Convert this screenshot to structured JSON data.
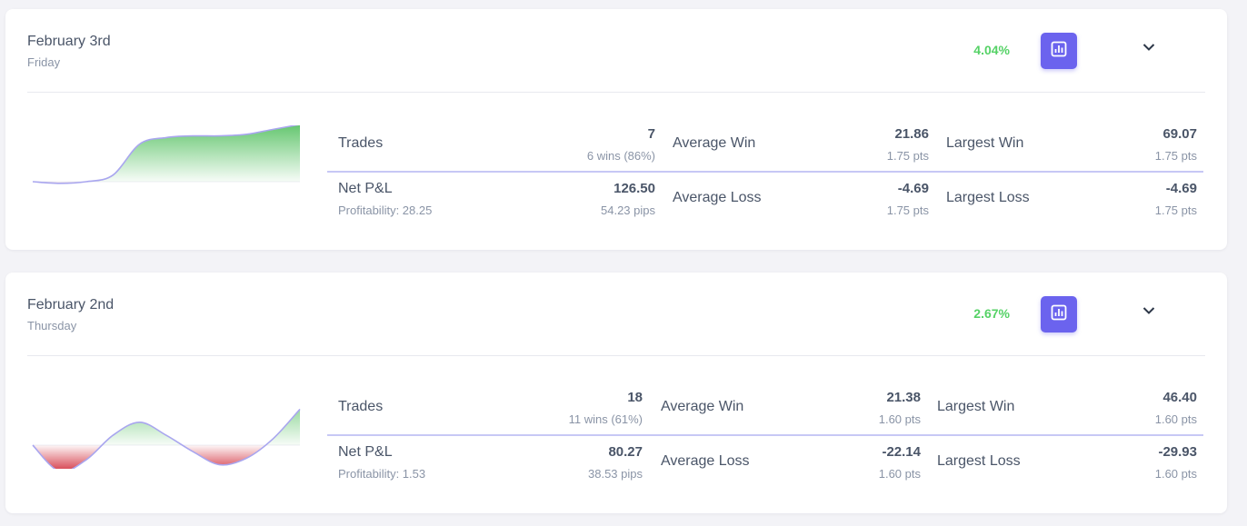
{
  "colors": {
    "accent": "#6b63ee",
    "positive_text": "#55d266",
    "area_positive": "#5fc46a",
    "area_negative": "#d9505c",
    "divider_accent": "#c7c8f5"
  },
  "icons": {
    "chart_button": "bar-chart-icon",
    "expand": "chevron-down-icon"
  },
  "days": [
    {
      "title": "February 3rd",
      "weekday": "Friday",
      "percent": "4.04%",
      "sparkline": [
        0,
        -0.5,
        0,
        2,
        11.5,
        13.5,
        14,
        14,
        14.5,
        16,
        17.5
      ],
      "stats": {
        "trades_label": "Trades",
        "trades_value": "7",
        "trades_sub": "6 wins (86%)",
        "avg_win_label": "Average Win",
        "avg_win_value": "21.86",
        "avg_win_sub": "1.75 pts",
        "largest_win_label": "Largest Win",
        "largest_win_value": "69.07",
        "largest_win_sub": "1.75 pts",
        "net_label": "Net P&L",
        "net_sub_label": "Profitability: 28.25",
        "net_value": "126.50",
        "net_sub": "54.23 pips",
        "avg_loss_label": "Average Loss",
        "avg_loss_value": "-4.69",
        "avg_loss_sub": "1.75 pts",
        "largest_loss_label": "Largest Loss",
        "largest_loss_value": "-4.69",
        "largest_loss_sub": "1.75 pts"
      }
    },
    {
      "title": "February 2nd",
      "weekday": "Thursday",
      "percent": "2.67%",
      "sparkline": [
        0,
        -8,
        -4.5,
        3,
        7,
        3,
        -2,
        -6,
        -4,
        2,
        11
      ],
      "stats": {
        "trades_label": "Trades",
        "trades_value": "18",
        "trades_sub": "11 wins (61%)",
        "avg_win_label": "Average Win",
        "avg_win_value": "21.38",
        "avg_win_sub": "1.60 pts",
        "largest_win_label": "Largest Win",
        "largest_win_value": "46.40",
        "largest_win_sub": "1.60 pts",
        "net_label": "Net P&L",
        "net_sub_label": "Profitability: 1.53",
        "net_value": "80.27",
        "net_sub": "38.53 pips",
        "avg_loss_label": "Average Loss",
        "avg_loss_value": "-22.14",
        "avg_loss_sub": "1.60 pts",
        "largest_loss_label": "Largest Loss",
        "largest_loss_value": "-29.93",
        "largest_loss_sub": "1.60 pts"
      }
    }
  ]
}
